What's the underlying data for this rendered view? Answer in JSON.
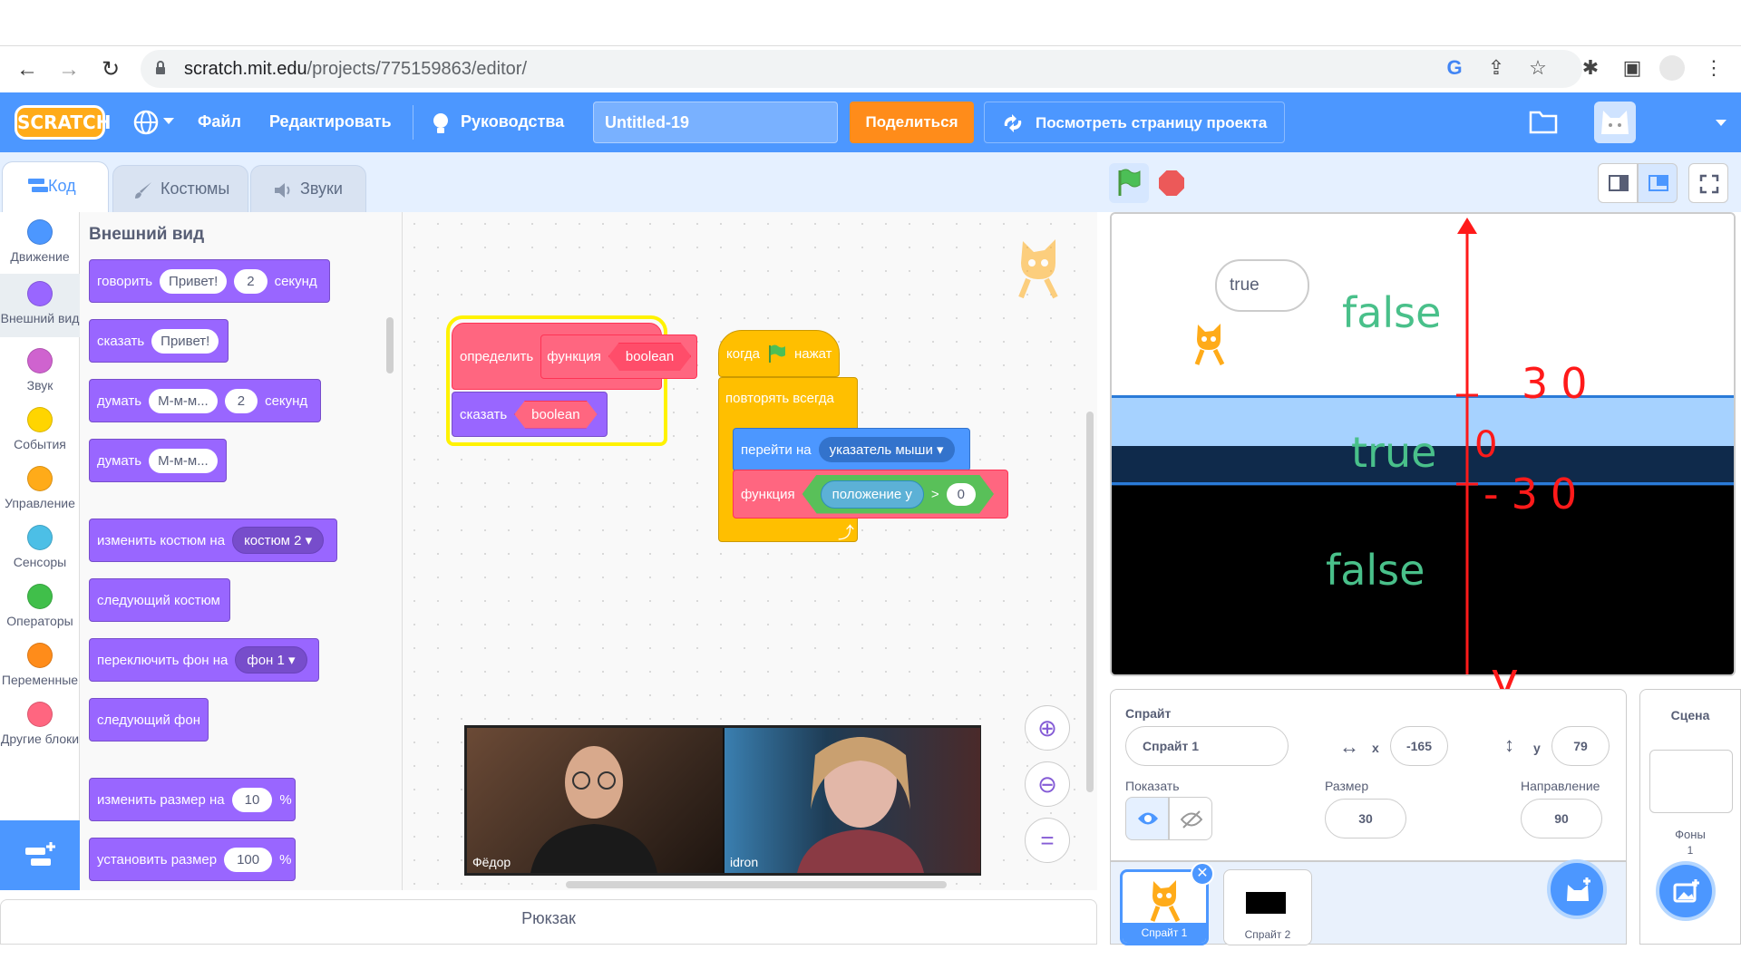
{
  "browser": {
    "url_host": "scratch.mit.edu",
    "url_path": "/projects/775159863/editor/"
  },
  "menu": {
    "logo": "SCRATCH",
    "file": "Файл",
    "edit": "Редактировать",
    "tutorials": "Руководства",
    "project_title": "Untitled-19",
    "share": "Поделиться",
    "see_project_page": "Посмотреть страницу проекта"
  },
  "tabs": {
    "code": "Код",
    "costumes": "Костюмы",
    "sounds": "Звуки"
  },
  "categories": [
    {
      "label": "Движение",
      "color": "#4c97ff"
    },
    {
      "label": "Внешний вид",
      "color": "#9966ff"
    },
    {
      "label": "Звук",
      "color": "#cf63cf"
    },
    {
      "label": "События",
      "color": "#ffd500"
    },
    {
      "label": "Управление",
      "color": "#ffab19"
    },
    {
      "label": "Сенсоры",
      "color": "#4cbfe6"
    },
    {
      "label": "Операторы",
      "color": "#40bf4a"
    },
    {
      "label": "Переменные",
      "color": "#ff8c1a"
    },
    {
      "label": "Другие блоки",
      "color": "#ff6680"
    }
  ],
  "palette": {
    "title": "Внешний вид",
    "say_for": {
      "verb": "говорить",
      "text": "Привет!",
      "secs": "2",
      "unit": "секунд"
    },
    "say": {
      "verb": "сказать",
      "text": "Привет!"
    },
    "think_for": {
      "verb": "думать",
      "text": "М-м-м...",
      "secs": "2",
      "unit": "секунд"
    },
    "think": {
      "verb": "думать",
      "text": "М-м-м..."
    },
    "switch_costume": {
      "label": "изменить костюм на",
      "value": "костюм 2"
    },
    "next_costume": "следующий костюм",
    "switch_backdrop": {
      "label": "переключить фон на",
      "value": "фон 1"
    },
    "next_backdrop": "следующий фон",
    "change_size": {
      "label": "изменить размер на",
      "value": "10",
      "unit": "%"
    },
    "set_size": {
      "label": "установить размер",
      "value": "100",
      "unit": "%"
    }
  },
  "script": {
    "define": "определить",
    "func_name": "функция",
    "param": "boolean",
    "say": "сказать",
    "say_param": "boolean",
    "when": "когда",
    "clicked": "нажат",
    "forever": "повторять всегда",
    "goto": "перейти на",
    "goto_target": "указатель мыши",
    "call_func": "функция",
    "pos_y": "положение y",
    "gt": ">",
    "zero": "0"
  },
  "video": {
    "left_name": "Фёдор",
    "right_name": "idron"
  },
  "backpack": "Рюкзак",
  "stage": {
    "bubble": "true",
    "word_top": "false",
    "word_mid": "true",
    "word_bottom": "false",
    "annot_30": "30",
    "annot_0": "0",
    "annot_neg30": "-30",
    "annot_y": "y"
  },
  "sprite_info": {
    "sprite_label": "Спрайт",
    "sprite_name": "Спрайт 1",
    "x_label": "x",
    "x_value": "-165",
    "y_label": "y",
    "y_value": "79",
    "show_label": "Показать",
    "size_label": "Размер",
    "size_value": "30",
    "direction_label": "Направление",
    "direction_value": "90"
  },
  "sprites": [
    "Спрайт 1",
    "Спрайт 2"
  ],
  "stage_pane": {
    "title": "Сцена",
    "backdrops_label": "Фоны",
    "backdrops_count": "1"
  }
}
